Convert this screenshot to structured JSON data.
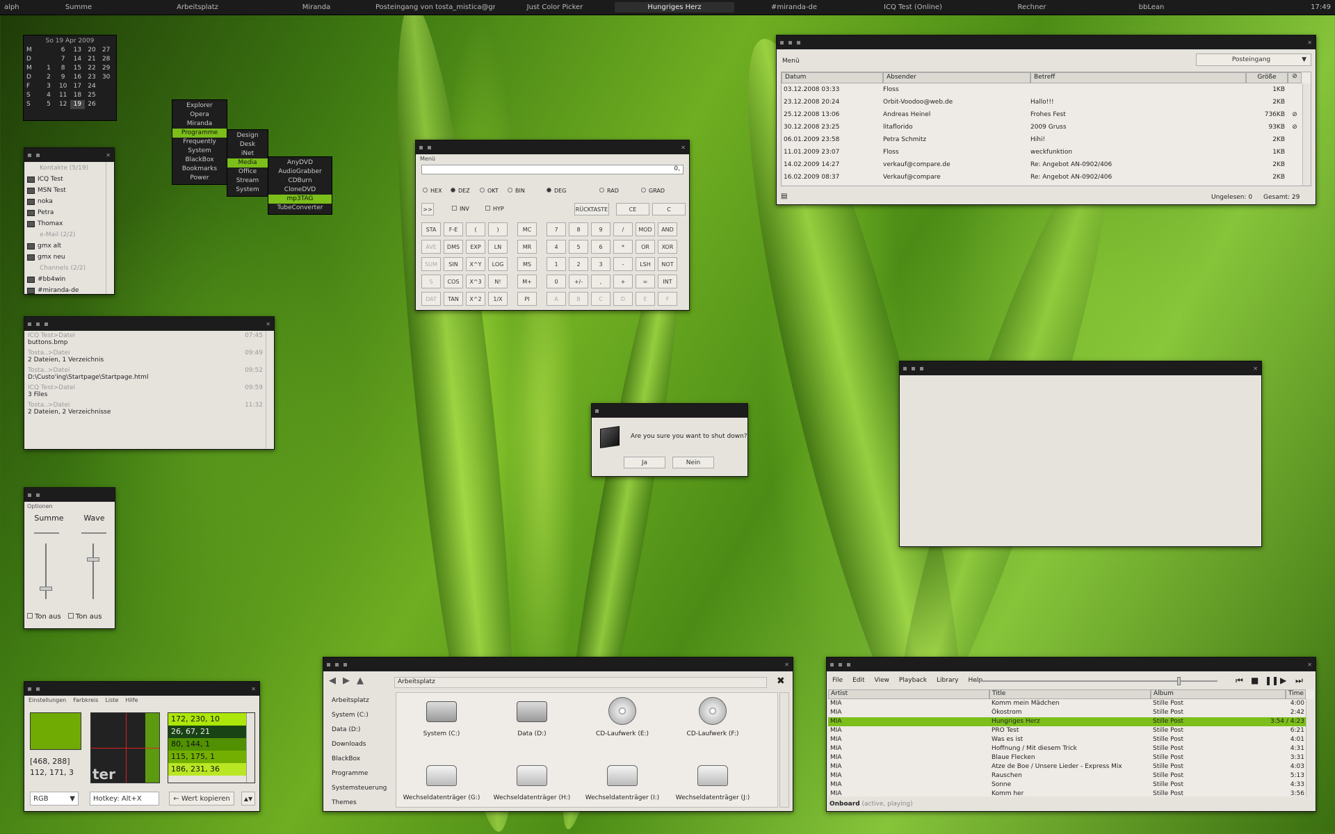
{
  "taskbar": {
    "items": [
      "alpha",
      "Summe",
      "Arbeitsplatz",
      "Miranda",
      "Posteingang von tosta_mistica@gmx.de ...",
      "Just Color Picker",
      "Hungriges Herz",
      "#miranda-de",
      "ICQ Test (Online)",
      "Rechner",
      "bbLean"
    ],
    "clock": "17:49"
  },
  "calendar": {
    "title": "So 19 Apr 2009",
    "rows": [
      [
        "M",
        "",
        "6",
        "13",
        "20",
        "27"
      ],
      [
        "D",
        "",
        "7",
        "14",
        "21",
        "28"
      ],
      [
        "M",
        "1",
        "8",
        "15",
        "22",
        "29"
      ],
      [
        "D",
        "2",
        "9",
        "16",
        "23",
        "30"
      ],
      [
        "F",
        "3",
        "10",
        "17",
        "24",
        ""
      ],
      [
        "S",
        "4",
        "11",
        "18",
        "25",
        ""
      ],
      [
        "S",
        "5",
        "12",
        "19",
        "26",
        ""
      ]
    ]
  },
  "menu": {
    "main": [
      "Explorer",
      "Opera",
      "Miranda",
      "Programme",
      "Frequently",
      "System",
      "BlackBox",
      "Bookmarks",
      "Power"
    ],
    "programme": [
      "Design",
      "Desk",
      "iNet",
      "Media",
      "Office",
      "Stream",
      "System"
    ],
    "media": [
      "AnyDVD",
      "AudioGrabber",
      "CDBurn",
      "CloneDVD",
      "mp3TAG",
      "TubeConverter"
    ]
  },
  "contacts": {
    "items": [
      {
        "t": "Kontakte (5/19)",
        "g": true
      },
      {
        "t": "ICQ Test"
      },
      {
        "t": "MSN Test"
      },
      {
        "t": "noka"
      },
      {
        "t": "Petra"
      },
      {
        "t": "Thomax"
      },
      {
        "t": "e-Mail (2/2)",
        "g": true
      },
      {
        "t": "gmx alt"
      },
      {
        "t": "gmx neu"
      },
      {
        "t": "Channels (2/2)",
        "g": true
      },
      {
        "t": "#bb4win"
      },
      {
        "t": "#miranda-de"
      }
    ]
  },
  "history": {
    "items": [
      {
        "from": "ICQ Test>Datei",
        "time": "07:45",
        "text": "buttons.bmp"
      },
      {
        "from": "Tosta..>Datei",
        "time": "09:49",
        "text": "2 Dateien, 1 Verzeichnis"
      },
      {
        "from": "Tosta..>Datei",
        "time": "09:52",
        "text": "D:\\Custo'ing\\Startpage\\Startpage.html"
      },
      {
        "from": "ICQ Test>Datei",
        "time": "09:59",
        "text": "3 Files"
      },
      {
        "from": "Tosta..>Datei",
        "time": "11:32",
        "text": "2 Dateien, 2 Verzeichnisse"
      }
    ]
  },
  "mixer": {
    "menu": "Optionen",
    "ch1": "Summe",
    "ch2": "Wave",
    "mute": "Ton aus"
  },
  "picker": {
    "menu": [
      "Einstellungen",
      "Farbkreis",
      "Liste",
      "Hilfe"
    ],
    "pos": "[468, 288]",
    "rgb": "112, 171, 3",
    "colors": [
      {
        "t": "172, 230, 10",
        "c": "#ace60a"
      },
      {
        "t": "26, 67, 21",
        "c": "#1a4315"
      },
      {
        "t": "80, 144, 1",
        "c": "#509001"
      },
      {
        "t": "115, 175, 1",
        "c": "#73af01"
      },
      {
        "t": "186, 231, 36",
        "c": "#bae724"
      }
    ],
    "mode": "RGB",
    "hotkey": "Hotkey: Alt+X",
    "copy": "← Wert kopieren",
    "swatch": "#70ab03",
    "zoomtext": "ter"
  },
  "calc": {
    "menu": "Menü",
    "display": "0,",
    "radio1": [
      "HEX",
      "DEZ",
      "OKT",
      "BIN"
    ],
    "radio2": [
      "DEG",
      "RAD",
      "GRAD"
    ],
    "chk": [
      "INV",
      "HYP"
    ],
    "top": [
      ">>",
      "RÜCKTASTE",
      "CE",
      "C"
    ],
    "keys": [
      [
        "STA",
        "F-E",
        "(",
        ")",
        "MC",
        "7",
        "8",
        "9",
        "/",
        "MOD",
        "AND"
      ],
      [
        "AVE",
        "DMS",
        "EXP",
        "LN",
        "MR",
        "4",
        "5",
        "6",
        "*",
        "OR",
        "XOR"
      ],
      [
        "SUM",
        "SIN",
        "X^Y",
        "LOG",
        "MS",
        "1",
        "2",
        "3",
        "-",
        "LSH",
        "NOT"
      ],
      [
        "S",
        "COS",
        "X^3",
        "N!",
        "M+",
        "0",
        "+/-",
        ",",
        "+",
        "=",
        "INT"
      ],
      [
        "DAT",
        "TAN",
        "X^2",
        "1/X",
        "PI",
        "A",
        "B",
        "C",
        "D",
        "E",
        "F"
      ]
    ]
  },
  "dialog": {
    "text": "Are you sure you want to shut down?",
    "yes": "Ja",
    "no": "Nein"
  },
  "mail": {
    "menu": "Menü",
    "folder": "Posteingang",
    "cols": [
      "Datum",
      "Absender",
      "Betreff",
      "Größe"
    ],
    "rows": [
      [
        "03.12.2008 03:33",
        "Floss",
        "",
        "1KB",
        0
      ],
      [
        "23.12.2008 20:24",
        "Orbit-Voodoo@web.de",
        "Hallo!!!",
        "2KB",
        0
      ],
      [
        "25.12.2008 13:06",
        "Andreas Heinel",
        "Frohes Fest",
        "736KB",
        1
      ],
      [
        "30.12.2008 23:25",
        "litaflorido",
        "2009 Gruss",
        "93KB",
        1
      ],
      [
        "06.01.2009 23:58",
        "Petra Schmitz",
        "Hihi!",
        "2KB",
        0
      ],
      [
        "11.01.2009 23:07",
        "Floss",
        "weckfunktion",
        "1KB",
        0
      ],
      [
        "14.02.2009 14:27",
        "verkauf@compare.de",
        "Re: Angebot AN-0902/406",
        "2KB",
        0
      ],
      [
        "16.02.2009 08:37",
        "Verkauf@compare",
        "Re: Angebot AN-0902/406",
        "2KB",
        0
      ]
    ],
    "unread": "Ungelesen: 0",
    "total": "Gesamt: 29"
  },
  "explorer": {
    "address": "Arbeitsplatz",
    "nav": [
      "Arbeitsplatz",
      "System (C:)",
      "Data (D:)",
      "Downloads",
      "BlackBox",
      "Programme",
      "Systemsteuerung",
      "Themes"
    ],
    "drives": [
      {
        "n": "System (C:)",
        "k": "hdd"
      },
      {
        "n": "Data (D:)",
        "k": "hdd"
      },
      {
        "n": "CD-Laufwerk (E:)",
        "k": "cd"
      },
      {
        "n": "CD-Laufwerk (F:)",
        "k": "cd"
      },
      {
        "n": "Wechseldatenträger (G:)",
        "k": "rem"
      },
      {
        "n": "Wechseldatenträger (H:)",
        "k": "rem"
      },
      {
        "n": "Wechseldatenträger (I:)",
        "k": "rem"
      },
      {
        "n": "Wechseldatenträger (J:)",
        "k": "rem"
      }
    ]
  },
  "player": {
    "menu": [
      "File",
      "Edit",
      "View",
      "Playback",
      "Library",
      "Help"
    ],
    "cols": [
      "Artist",
      "Title",
      "Album",
      "Time"
    ],
    "rows": [
      [
        "MIA",
        "Komm mein Mädchen",
        "Stille Post",
        "4:00"
      ],
      [
        "MIA",
        "Ökostrom",
        "Stille Post",
        "2:42"
      ],
      [
        "MIA",
        "Hungriges Herz",
        "Stille Post",
        "3:54 / 4:23"
      ],
      [
        "MIA",
        "PRO Test",
        "Stille Post",
        "6:21"
      ],
      [
        "MIA",
        "Was es ist",
        "Stille Post",
        "4:01"
      ],
      [
        "MIA",
        "Hoffnung / Mit diesem Trick",
        "Stille Post",
        "4:31"
      ],
      [
        "MIA",
        "Blaue Flecken",
        "Stille Post",
        "3:31"
      ],
      [
        "MIA",
        "Atze de Boe / Unsere Lieder - Express Mix",
        "Stille Post",
        "4:03"
      ],
      [
        "MIA",
        "Rauschen",
        "Stille Post",
        "5:13"
      ],
      [
        "MIA",
        "Sonne",
        "Stille Post",
        "4:33"
      ],
      [
        "MIA",
        "Komm her",
        "Stille Post",
        "3:56"
      ]
    ],
    "status": "Onboard",
    "status2": "(active, playing)",
    "selected": 2
  }
}
